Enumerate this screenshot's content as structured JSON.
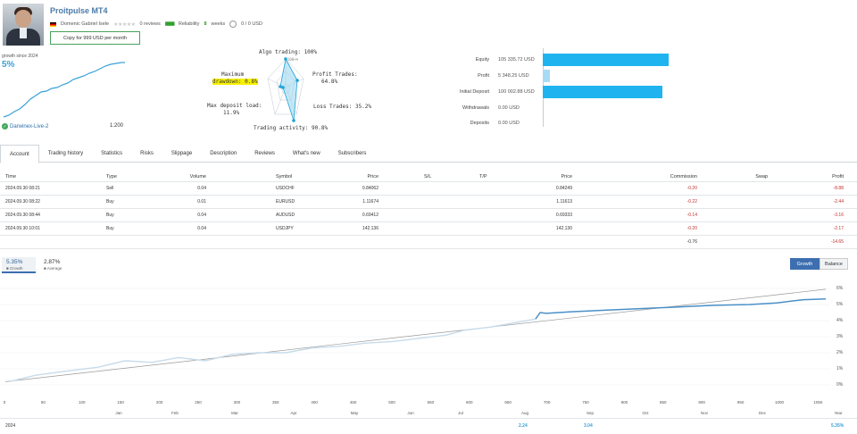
{
  "signal": {
    "title": "Proitpulse MT4",
    "author": "Domenic Gabriel Isele",
    "reviews": "0 reviews",
    "reliability": "Reliability",
    "weeks_num": "8",
    "weeks": "weeks",
    "subscribers": "0 / 0 USD",
    "copy_button": "Copy for 999 USD per month",
    "growth_since": "growth since 2024",
    "growth_value": "5%",
    "broker": "Darwinex-Live-2",
    "leverage": "1:200"
  },
  "radar": {
    "algo": "Algo trading: 100%",
    "profit": "Profit Trades:",
    "profit_v": "64.8%",
    "max_dd1": "Maximum",
    "max_dd2": "drawdown: 0.8%",
    "max_dep1": "Max deposit load:",
    "max_dep2": "11.9%",
    "loss": "Loss Trades: 35.2%",
    "activity": "Trading activity: 90.8%",
    "ring100": "100+%"
  },
  "equity": [
    {
      "label": "Equity",
      "value": "105 335.72 USD",
      "fraction": 1.0,
      "style": "dark"
    },
    {
      "label": "Profit",
      "value": "5 348.25 USD",
      "fraction": 0.06,
      "style": "light"
    },
    {
      "label": "Initial Deposit",
      "value": "100 002.88 USD",
      "fraction": 0.95,
      "style": "dark"
    },
    {
      "label": "Withdrawals",
      "value": "0.00 USD",
      "fraction": 0,
      "style": "dark"
    },
    {
      "label": "Deposits",
      "value": "0.00 USD",
      "fraction": 0,
      "style": "dark"
    }
  ],
  "tabs": [
    "Account",
    "Trading history",
    "Statistics",
    "Risks",
    "Slippage",
    "Description",
    "Reviews",
    "What's new",
    "Subscribers"
  ],
  "table": {
    "headers": [
      "Time",
      "Type",
      "Volume",
      "Symbol",
      "Price",
      "S/L",
      "T/P",
      "Price",
      "Commission",
      "Swap",
      "Profit"
    ],
    "rows": [
      [
        "2024.09.30 08:21",
        "Sell",
        "0.04",
        "USDCHF",
        "0.84062",
        "",
        "",
        "0.84249",
        "-0.20",
        "",
        "-8.88"
      ],
      [
        "2024.09.30 08:22",
        "Buy",
        "0.01",
        "EURUSD",
        "1.11674",
        "",
        "",
        "1.11613",
        "-0.22",
        "",
        "-2.44"
      ],
      [
        "2024.09.30 08:44",
        "Buy",
        "0.04",
        "AUDUSD",
        "0.69412",
        "",
        "",
        "0.69333",
        "-0.14",
        "",
        "-3.16"
      ],
      [
        "2024.09.30 10:01",
        "Buy",
        "0.04",
        "USDJPY",
        "142.136",
        "",
        "",
        "142.130",
        "-0.20",
        "",
        "-2.17"
      ]
    ],
    "totals": {
      "commission": "-0.76",
      "profit": "-14.65"
    }
  },
  "growth_chart": {
    "tab1_value": "5.35%",
    "tab1_label": "Growth",
    "tab2_value": "2.87%",
    "tab2_label": "Average",
    "btn_growth": "Growth",
    "btn_balance": "Balance",
    "y_ticks": [
      "0%",
      "1%",
      "2%",
      "3%",
      "4%",
      "5%",
      "6%"
    ],
    "x_ticks": [
      "0",
      "50",
      "100",
      "150",
      "200",
      "250",
      "300",
      "350",
      "400",
      "450",
      "500",
      "550",
      "600",
      "650",
      "700",
      "750",
      "800",
      "850",
      "900",
      "950",
      "1000",
      "1050"
    ],
    "months": [
      "Jan",
      "Feb",
      "Mar",
      "Apr",
      "May",
      "Jun",
      "Jul",
      "Aug",
      "Sep",
      "Oct",
      "Nov",
      "Dec",
      "Year"
    ],
    "year_row": {
      "year": "2024",
      "aug": "2.24",
      "sep": "3.04",
      "total": "5.35%"
    },
    "colors": {
      "line": "#4a90c8",
      "light_line": "#c7dbea",
      "trend": "#999999"
    }
  }
}
